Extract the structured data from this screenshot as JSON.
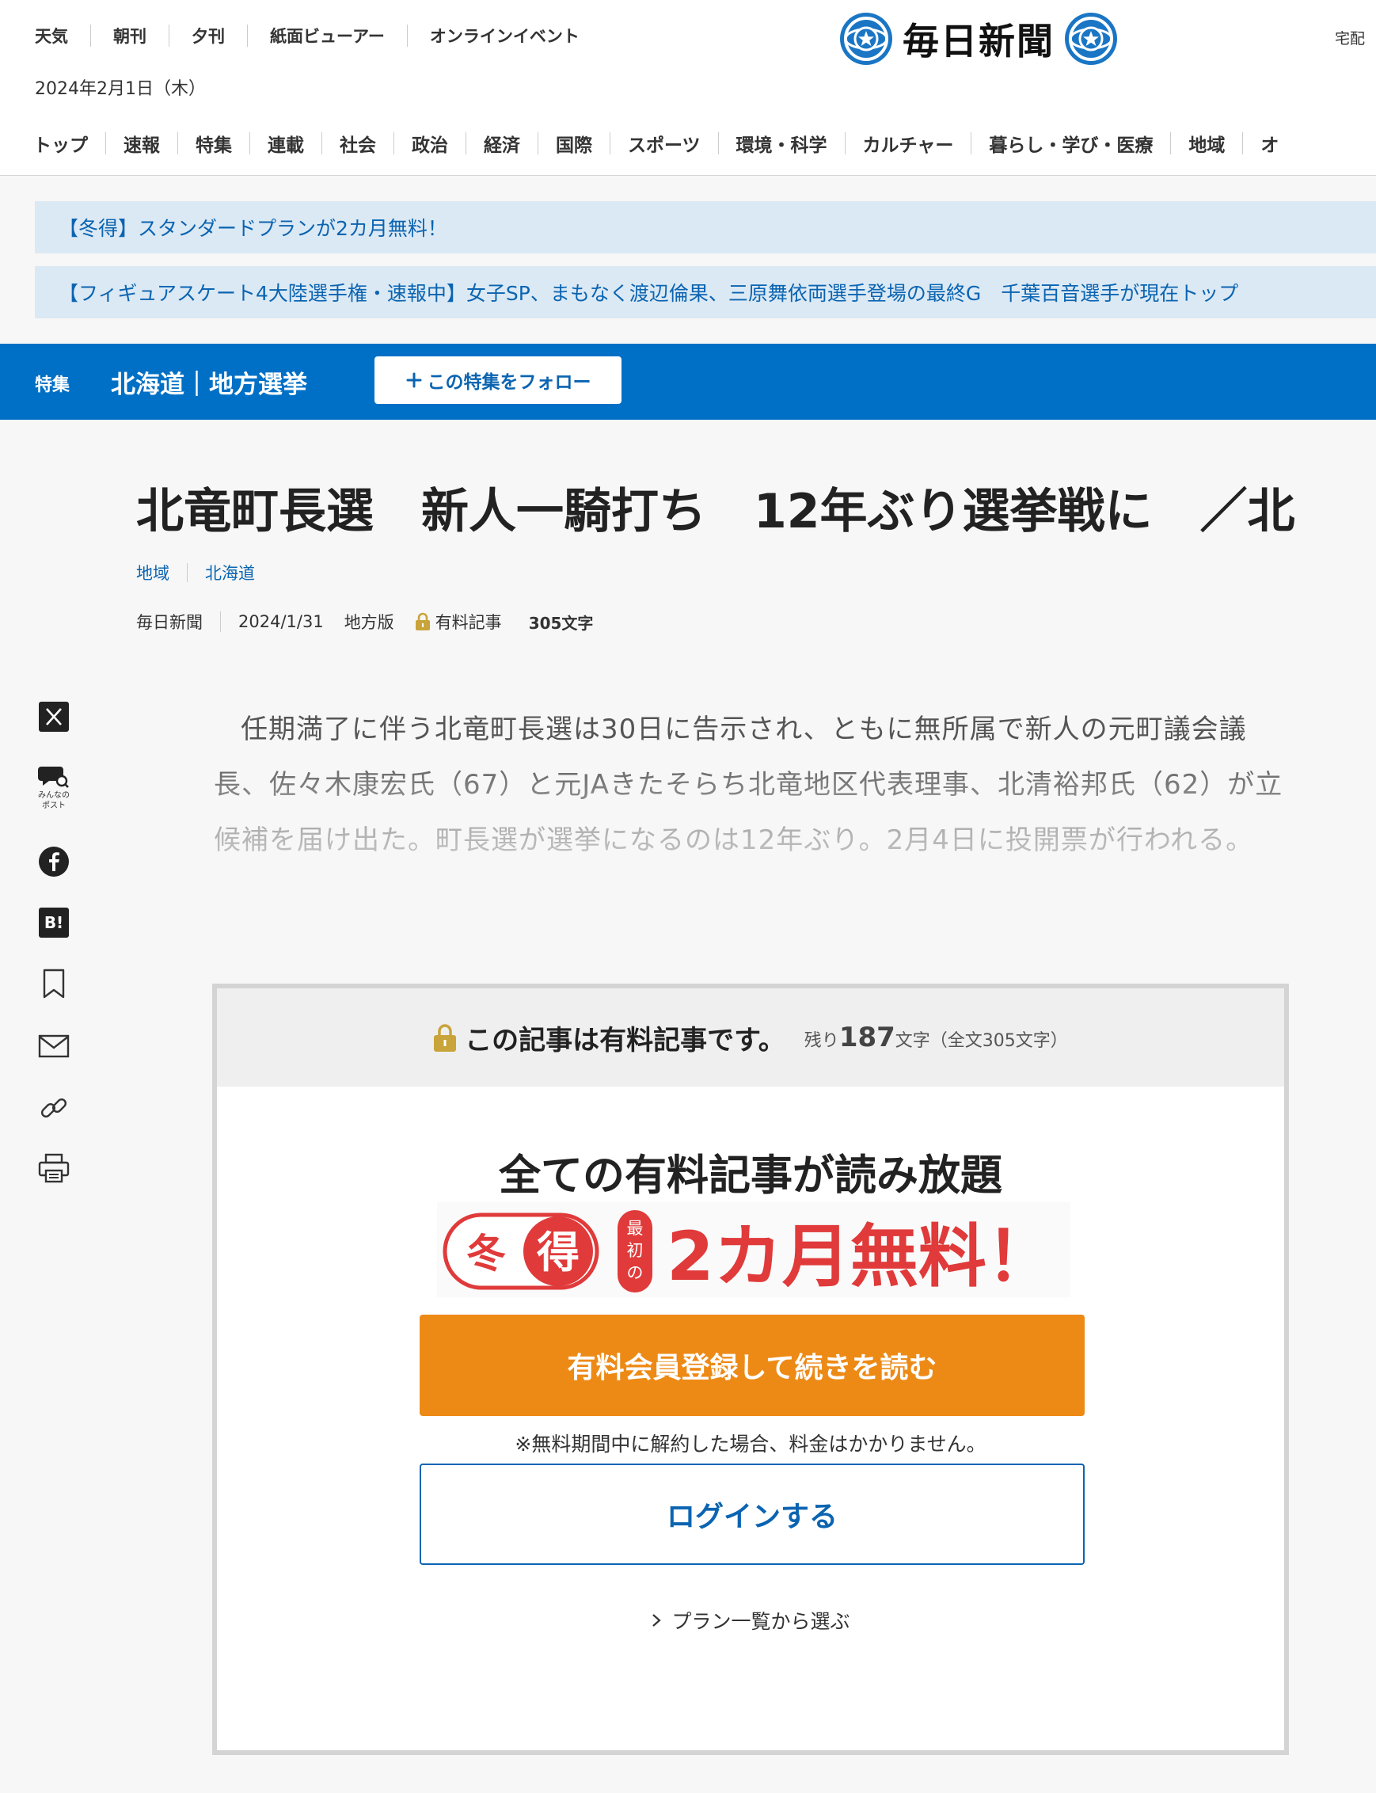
{
  "header": {
    "utility_links": [
      "天気",
      "朝刊",
      "夕刊",
      "紙面ビューアー",
      "オンラインイベント"
    ],
    "date": "2024年2月1日（木）",
    "logo_text": "毎日新聞",
    "delivery_label": "宅配",
    "nav": [
      "トップ",
      "速報",
      "特集",
      "連載",
      "社会",
      "政治",
      "経済",
      "国際",
      "スポーツ",
      "環境・科学",
      "カルチャー",
      "暮らし・学び・医療",
      "地域",
      "オ"
    ]
  },
  "notices": [
    "【冬得】スタンダードプランが2カ月無料！",
    "【フィギュアスケート4大陸選手権・速報中】女子SP、まもなく渡辺倫果、三原舞依両選手登場の最終G　千葉百音選手が現在トップ"
  ],
  "feature": {
    "label": "特集",
    "title": "北海道｜地方選挙",
    "follow_label": "この特集をフォロー"
  },
  "article": {
    "title": "北竜町長選　新人一騎打ち　12年ぶり選挙戦に　／北",
    "categories": [
      "地域",
      "北海道"
    ],
    "source": "毎日新聞",
    "date": "2024/1/31",
    "edition": "地方版",
    "paid_label": "有料記事",
    "char_count": "305文字",
    "lead": "任期満了に伴う北竜町長選は30日に告示され、ともに無所属で新人の元町議会議長、佐々木康宏氏（67）と元JAきたそらち北竜地区代表理事、北清裕邦氏（62）が立候補を届け出た。町長選が選挙になるのは12年ぶり。2月4日に投開票が行われる。"
  },
  "share": {
    "post_label_line1": "みんなの",
    "post_label_line2": "ポスト",
    "hatena_label": "B!"
  },
  "paywall": {
    "heading": "この記事は有料記事です。",
    "remaining_prefix": "残り",
    "remaining_count": "187",
    "remaining_suffix": "文字（全文305文字）",
    "title": "全ての有料記事が読み放題",
    "promo": {
      "badge_char_1": "冬",
      "badge_char_2": "得",
      "first_label_1": "最",
      "first_label_2": "初",
      "first_label_3": "の",
      "headline": "2カ月無料！"
    },
    "cta_label": "有料会員登録して続きを読む",
    "note": "※無料期間中に解約した場合、料金はかかりません。",
    "login_label": "ログインする",
    "plans_label": "プラン一覧から選ぶ"
  },
  "colors": {
    "brand_blue": "#0070c6",
    "link_blue": "#0b64b1",
    "notice_bg": "#dbe9f4",
    "cta_orange": "#ed8a16",
    "promo_red": "#e03a3a",
    "promo_pink": "#f26d7d",
    "lock_gold": "#c9a43b"
  }
}
